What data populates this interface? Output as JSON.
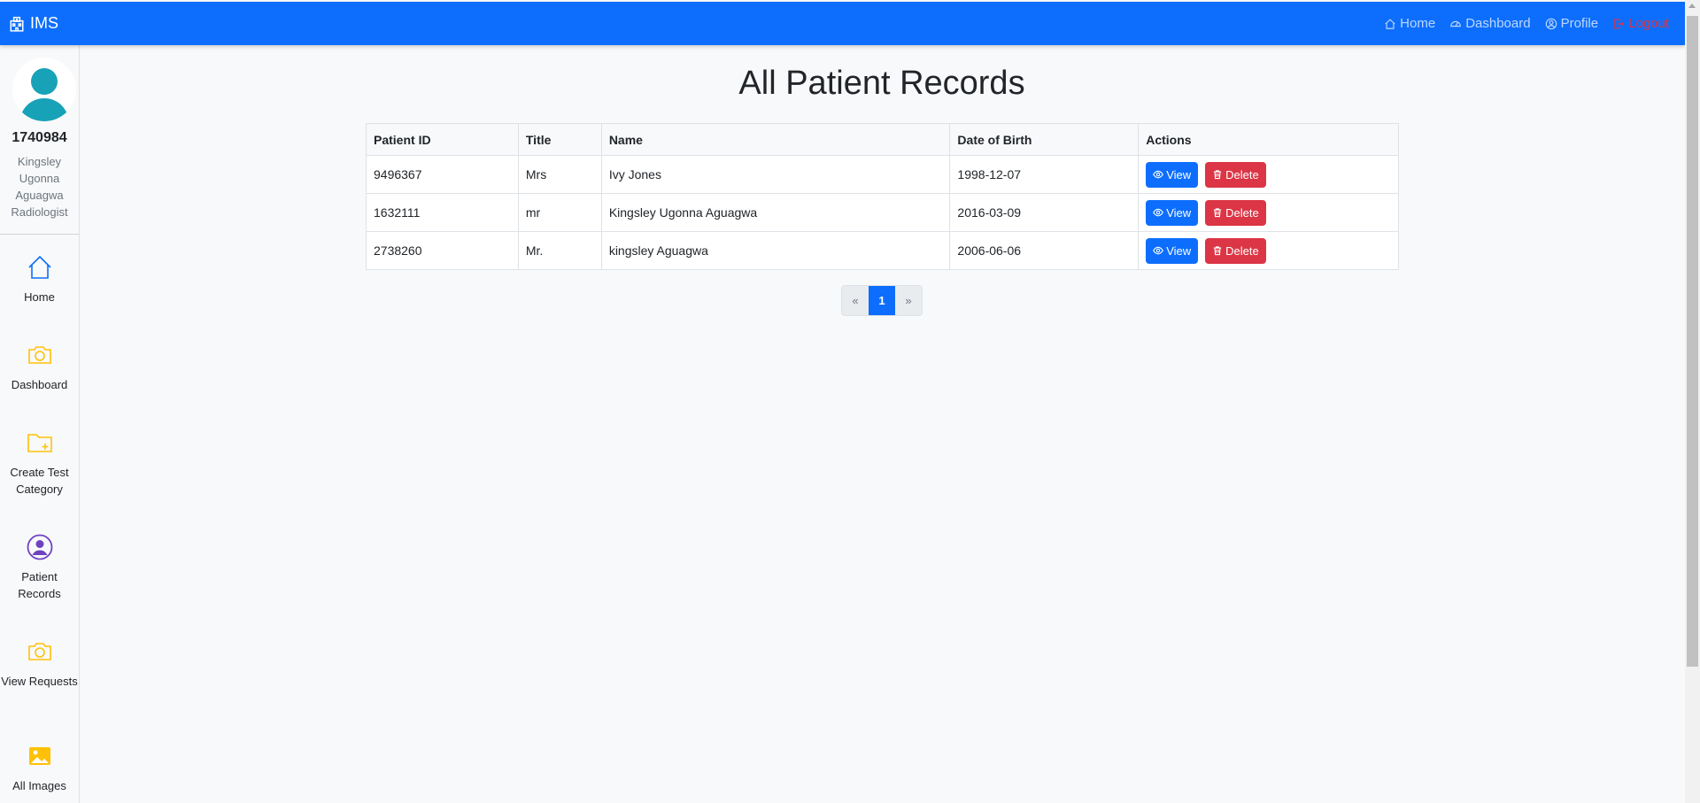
{
  "navbar": {
    "brand": "IMS",
    "links": [
      {
        "label": "Home",
        "icon": "home-icon"
      },
      {
        "label": "Dashboard",
        "icon": "speedometer-icon"
      },
      {
        "label": "Profile",
        "icon": "person-circle-icon"
      },
      {
        "label": "Logout",
        "icon": "box-arrow-right-icon"
      }
    ]
  },
  "sidebar": {
    "user_id": "1740984",
    "user_name": "Kingsley Ugonna Aguagwa",
    "user_role": "Radiologist",
    "items": [
      {
        "label": "Home",
        "icon": "house-icon"
      },
      {
        "label": "Dashboard",
        "icon": "camera-icon"
      },
      {
        "label": "Create Test Category",
        "icon": "folder-plus-icon"
      },
      {
        "label": "Patient Records",
        "icon": "person-circle-icon"
      },
      {
        "label": "View Requests",
        "icon": "camera-icon"
      },
      {
        "label": "All Images",
        "icon": "image-icon"
      }
    ]
  },
  "main": {
    "title": "All Patient Records",
    "columns": [
      "Patient ID",
      "Title",
      "Name",
      "Date of Birth",
      "Actions"
    ],
    "rows": [
      {
        "id": "9496367",
        "title": "Mrs",
        "name": "Ivy Jones",
        "dob": "1998-12-07"
      },
      {
        "id": "1632111",
        "title": "mr",
        "name": "Kingsley Ugonna Aguagwa",
        "dob": "2016-03-09"
      },
      {
        "id": "2738260",
        "title": "Mr.",
        "name": "kingsley Aguagwa",
        "dob": "2006-06-06"
      }
    ],
    "actions": {
      "view": "View",
      "delete": "Delete"
    },
    "pagination": {
      "prev": "«",
      "current": "1",
      "next": "»"
    }
  },
  "colors": {
    "primary": "#0d6efd",
    "danger": "#dc3545",
    "icon_amber": "#ffc107",
    "icon_purple": "#6f42c1",
    "avatar": "#17a2b8"
  }
}
